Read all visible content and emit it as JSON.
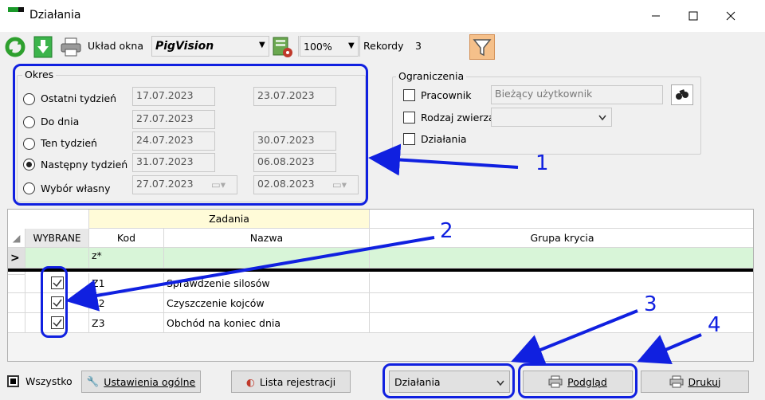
{
  "window": {
    "title": "Działania",
    "minimize": "—",
    "maximize": "☐",
    "close": "✕"
  },
  "toolbar": {
    "layout_label": "Układ okna",
    "layout_value": "PigVision",
    "zoom_value": "100%",
    "records_label": "Rekordy",
    "records_value": "3"
  },
  "okres": {
    "title": "Okres",
    "options": [
      {
        "label": "Ostatni tydzień",
        "from": "17.07.2023",
        "to": "23.07.2023",
        "selected": false
      },
      {
        "label": "Do dnia",
        "from": "27.07.2023",
        "to": "",
        "selected": false
      },
      {
        "label": "Ten tydzień",
        "from": "24.07.2023",
        "to": "30.07.2023",
        "selected": false
      },
      {
        "label": "Następny tydzień",
        "from": "31.07.2023",
        "to": "06.08.2023",
        "selected": true
      },
      {
        "label": "Wybór własny",
        "from": "27.07.2023",
        "to": "02.08.2023",
        "selected": false
      }
    ]
  },
  "ograniczenia": {
    "title": "Ograniczenia",
    "pracownik_label": "Pracownik",
    "pracownik_value": "Bieżący użytkownik",
    "rodzaj_label": "Rodzaj zwierza",
    "dzialania_label": "Działania"
  },
  "grid": {
    "group_header": "Zadania",
    "columns": {
      "wybrane": "WYBRANE",
      "kod": "Kod",
      "nazwa": "Nazwa",
      "grupa": "Grupa krycia"
    },
    "filter_marker": ">",
    "filter_kod": "z*",
    "rows": [
      {
        "kod": "Z1",
        "nazwa": "Sprawdzenie silosów",
        "grupa": "",
        "checked": true
      },
      {
        "kod": "Z2",
        "nazwa": "Czyszczenie kojców",
        "grupa": "",
        "checked": true
      },
      {
        "kod": "Z3",
        "nazwa": "Obchód na koniec dnia",
        "grupa": "",
        "checked": true
      }
    ]
  },
  "bottom": {
    "wszystko_label": "Wszystko",
    "ustawienia_label": "Ustawienia ogólne",
    "lista_label": "Lista rejestracji",
    "combo_value": "Działania",
    "podglad_label": "Podgląd",
    "drukuj_label": "Drukuj"
  },
  "annotations": [
    "1",
    "2",
    "3",
    "4"
  ],
  "colors": {
    "annotation": "#1020e0",
    "filter_row": "#d8f5d8",
    "group_header": "#fffbd8"
  }
}
